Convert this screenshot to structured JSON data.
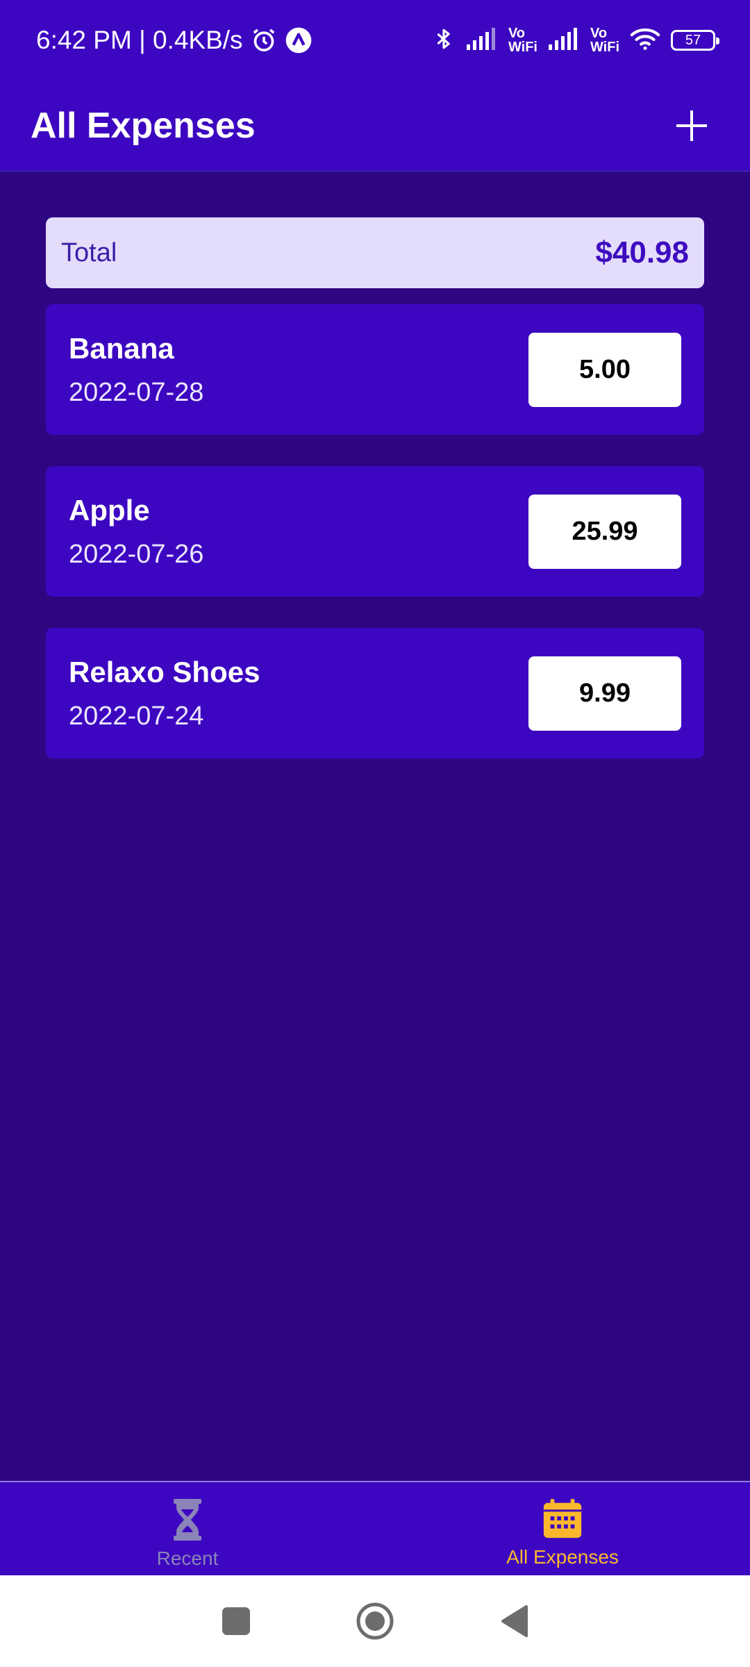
{
  "status_bar": {
    "time_speed": "6:42 PM | 0.4KB/s",
    "vowifi_1": [
      "Vo",
      "WiFi"
    ],
    "vowifi_2": [
      "Vo",
      "WiFi"
    ],
    "battery": "57"
  },
  "app_bar": {
    "title": "All Expenses"
  },
  "total": {
    "label": "Total",
    "value": "$40.98"
  },
  "expenses": [
    {
      "name": "Banana",
      "date": "2022-07-28",
      "amount": "5.00"
    },
    {
      "name": "Apple",
      "date": "2022-07-26",
      "amount": "25.99"
    },
    {
      "name": "Relaxo Shoes",
      "date": "2022-07-24",
      "amount": "9.99"
    }
  ],
  "bottom_nav": {
    "recent_label": "Recent",
    "all_label": "All Expenses"
  },
  "colors": {
    "background": "#2e0682",
    "primary": "#3d07c1",
    "accent": "#fbb82c",
    "total_bg": "#e4dcfb"
  }
}
